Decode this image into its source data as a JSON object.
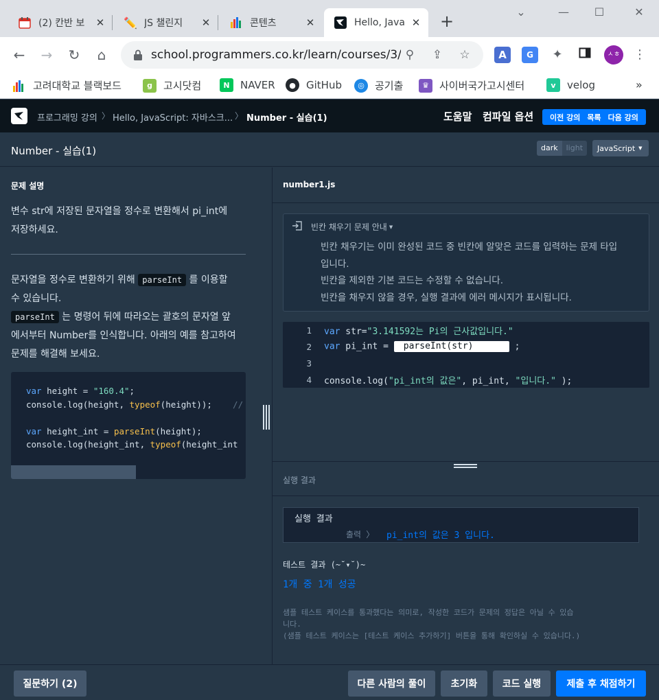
{
  "browser": {
    "tabs": [
      {
        "title": "(2) 칸반 보",
        "favicon": "calendar-icon"
      },
      {
        "title": "JS 챌린지",
        "favicon": "pencil-icon"
      },
      {
        "title": "콘텐츠",
        "favicon": "bar-chart-icon"
      },
      {
        "title": "Hello, Java",
        "favicon": "programmers-icon",
        "active": true
      }
    ],
    "url": "school.programmers.co.kr/learn/courses/3/l...",
    "profile_initials": "ㅅㅎ",
    "bookmarks": [
      {
        "label": "고려대학교 블랙보드",
        "icon": "blackboard-icon",
        "color": "#e53935"
      },
      {
        "label": "고시닷컴",
        "icon": "gosi-icon",
        "color": "#8bc34a"
      },
      {
        "label": "NAVER",
        "icon": "naver-icon",
        "color": "#03c75a"
      },
      {
        "label": "GitHub",
        "icon": "github-icon",
        "color": "#24292e"
      },
      {
        "label": "공기출",
        "icon": "gonggi-icon",
        "color": "#1e88e5"
      },
      {
        "label": "사이버국가고시센터",
        "icon": "cyber-icon",
        "color": "#7e57c2"
      },
      {
        "label": "velog",
        "icon": "velog-icon",
        "color": "#20c997"
      }
    ],
    "bookmarks_more": "»"
  },
  "header": {
    "breadcrumbs": [
      "프로그래밍 강의",
      "Hello, JavaScript: 자바스크...",
      "Number - 실습(1)"
    ],
    "links": [
      "도움말",
      "컴파일 옵션"
    ],
    "nav": [
      "이전 강의",
      "목록",
      "다음 강의"
    ]
  },
  "subheader": {
    "title": "Number - 실습(1)",
    "theme_dark": "dark",
    "theme_light": "light",
    "language": "JavaScript"
  },
  "problem": {
    "section_title": "문제 설명",
    "intro_1": "변수 str에 저장된 문자열을 정수로 변환해서 pi_int에",
    "intro_2": "저장하세요.",
    "body_1a": "문자열을 정수로 변환하기 위해",
    "body_code": "parseInt",
    "body_1b": "를 이용할",
    "body_2": "수 있습니다.",
    "body_3b": "는 명령어 뒤에 따라오는 괄호의 문자열 앞",
    "body_4": "에서부터 Number를 인식합니다. 아래의 예를 참고하여",
    "body_5": "문제를 해결해 보세요.",
    "example": [
      {
        "kw": "var",
        "rest1": " height = ",
        "str": "\"160.4\"",
        "rest2": ";"
      },
      {
        "plain": "console.log(height, ",
        "fn": "typeof",
        "rest": "(height));",
        "cmt": "    //"
      },
      {
        "kw": "var",
        "rest1": " height_int = ",
        "fn": "parseInt",
        "rest2": "(height);"
      },
      {
        "plain": "console.log(height_int, ",
        "fn": "typeof",
        "rest": "(height_int"
      }
    ]
  },
  "editor": {
    "filename": "number1.js",
    "guide_title": "빈칸 채우기 문제 안내",
    "guide_lines": [
      "빈칸 채우기는 이미 완성된 코드 중 빈칸에 알맞은 코드를 입력하는 문제 타입",
      "입니다.",
      "빈칸을 제외한 기본 코드는 수정할 수 없습니다.",
      "빈칸을 채우지 않을 경우, 실행 결과에 에러 메시지가 표시됩니다."
    ],
    "lines": [
      {
        "n": "1",
        "kw": "var",
        "a": " str=",
        "s": "\"3.141592는 Pi의 근사값입니다.\""
      },
      {
        "n": "2",
        "kw": "var",
        "a": " pi_int = ",
        "blank": "parseInt(str)",
        "b": " ;"
      },
      {
        "n": "3"
      },
      {
        "n": "4",
        "a": "console.log(",
        "s": "\"pi_int의 값은\"",
        "b": ", pi_int, ",
        "s2": "\"입니다.\"",
        "c": " );"
      }
    ]
  },
  "result": {
    "bar_label": "실행 결과",
    "box_title": "실행 결과",
    "output_label": "출력 〉",
    "output_value": "pi_int의 값은 3 입니다.",
    "test_heading": "테스트 결과 (~˘▾˘)~",
    "test_summary": "1개 중 1개 성공",
    "note_1": "샘플 테스트 케이스를 통과했다는 의미로, 작성한 코드가 문제의 정답은 아닐 수 있습",
    "note_2": "니다.",
    "note_3": "(샘플 테스트 케이스는 [테스트 케이스 추가하기] 버튼을 통해 확인하실 수 있습니다.)"
  },
  "footer": {
    "question": "질문하기 (2)",
    "others": "다른 사람의 풀이",
    "reset": "초기화",
    "run": "코드 실행",
    "submit": "제출 후 채점하기"
  }
}
